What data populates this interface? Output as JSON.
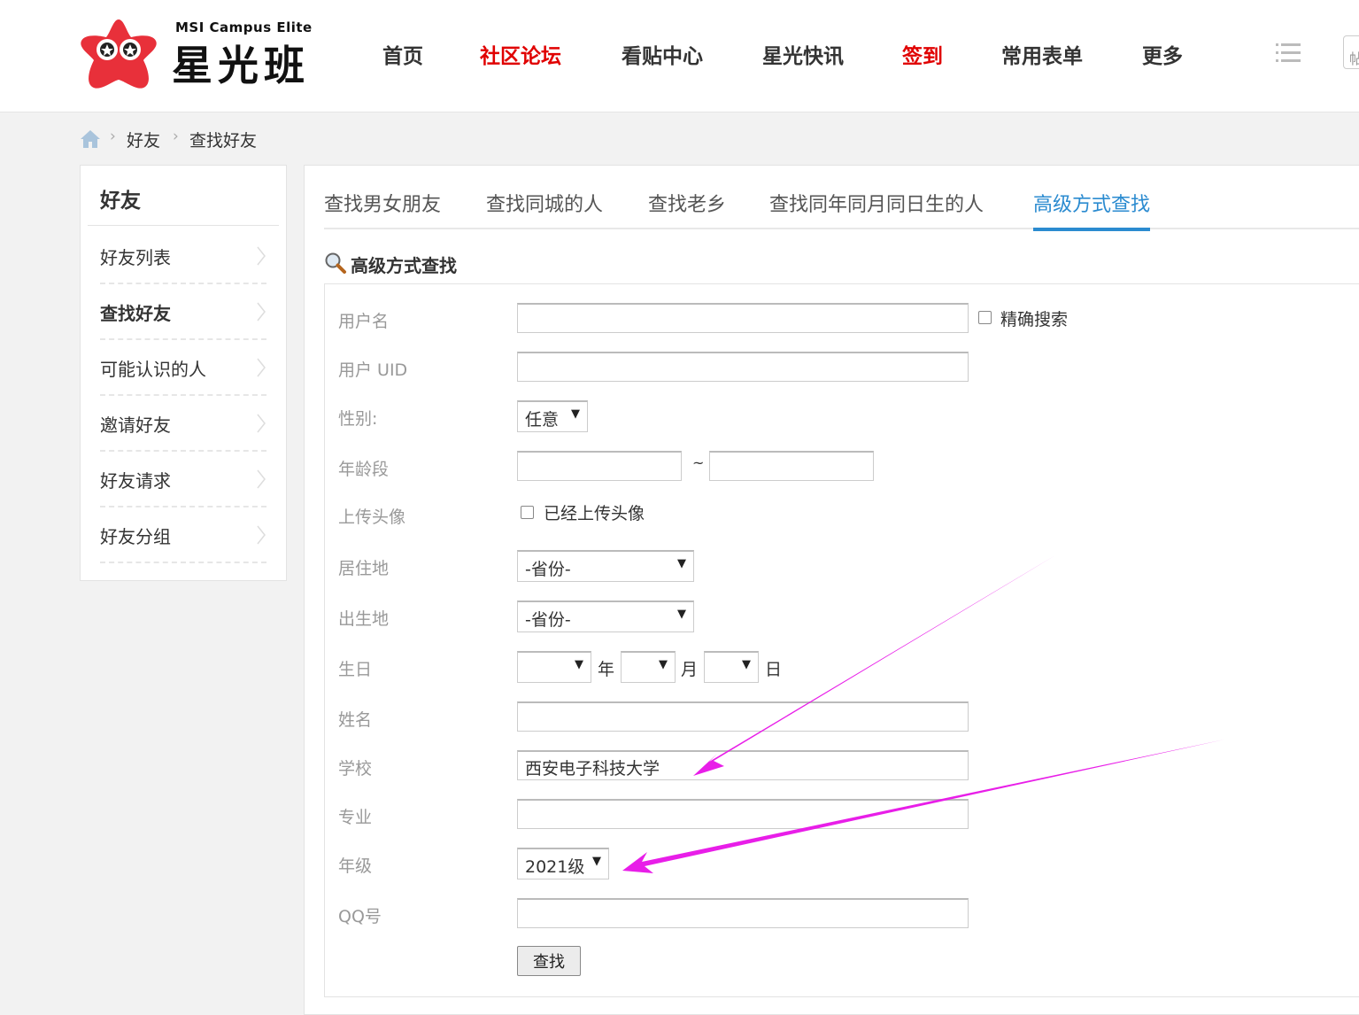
{
  "header": {
    "logo_sub": "MSI Campus Elite",
    "logo_main": "星光班",
    "nav": [
      "首页",
      "社区论坛",
      "看贴中心",
      "星光快讯",
      "签到",
      "常用表单",
      "更多"
    ],
    "search_partial": "帖"
  },
  "breadcrumb": [
    "好友",
    "查找好友"
  ],
  "sidebar": {
    "title": "好友",
    "items": [
      "好友列表",
      "查找好友",
      "可能认识的人",
      "邀请好友",
      "好友请求",
      "好友分组"
    ]
  },
  "tabs": [
    "查找男女朋友",
    "查找同城的人",
    "查找老乡",
    "查找同年同月同日生的人",
    "高级方式查找"
  ],
  "section_title": "高级方式查找",
  "form": {
    "username_label": "用户名",
    "exact_search_label": "精确搜索",
    "uid_label": "用户 UID",
    "gender_label": "性别:",
    "gender_value": "任意",
    "age_label": "年龄段",
    "age_sep": "~",
    "avatar_label": "上传头像",
    "avatar_checkbox_label": "已经上传头像",
    "residence_label": "居住地",
    "residence_value": "-省份-",
    "birthplace_label": "出生地",
    "birthplace_value": "-省份-",
    "birthday_label": "生日",
    "year_suffix": "年",
    "month_suffix": "月",
    "day_suffix": "日",
    "name_label": "姓名",
    "school_label": "学校",
    "school_value": "西安电子科技大学",
    "major_label": "专业",
    "grade_label": "年级",
    "grade_value": "2021级",
    "qq_label": "QQ号",
    "submit_label": "查找"
  },
  "colors": {
    "accent_red": "#e00000",
    "tab_active": "#2b8bd0",
    "annotation_arrow": "#e81ee8"
  }
}
